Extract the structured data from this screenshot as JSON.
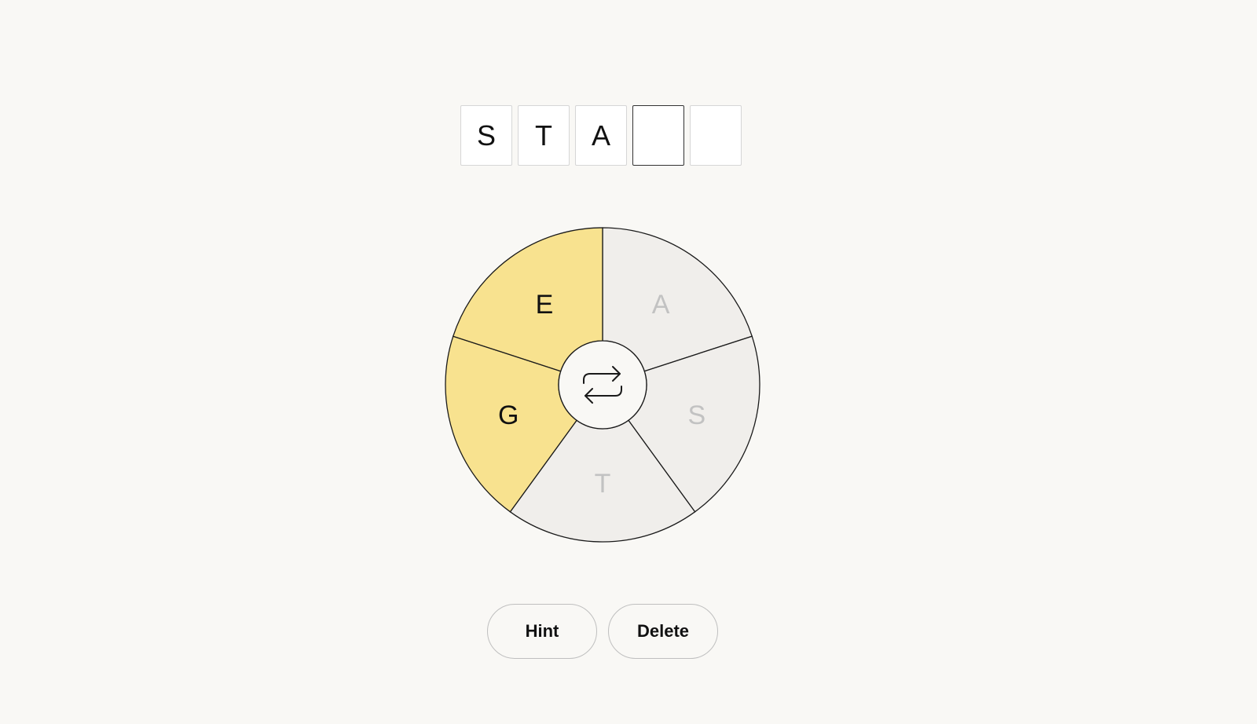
{
  "answer": {
    "slots": [
      {
        "letter": "S",
        "active": false
      },
      {
        "letter": "T",
        "active": false
      },
      {
        "letter": "A",
        "active": false
      },
      {
        "letter": "",
        "active": true
      },
      {
        "letter": "",
        "active": false
      }
    ]
  },
  "wheel": {
    "letters": [
      {
        "letter": "A",
        "state": "used"
      },
      {
        "letter": "S",
        "state": "used"
      },
      {
        "letter": "T",
        "state": "used"
      },
      {
        "letter": "G",
        "state": "available"
      },
      {
        "letter": "E",
        "state": "available"
      }
    ],
    "colors": {
      "available_fill": "#f8e28f",
      "used_fill": "#f0eeeb",
      "available_text": "#111111",
      "used_text": "#c2c2c2",
      "center_fill": "#f9f8f5",
      "stroke": "#1a1a1a"
    },
    "center_icon": "shuffle-icon"
  },
  "buttons": {
    "hint_label": "Hint",
    "delete_label": "Delete"
  }
}
